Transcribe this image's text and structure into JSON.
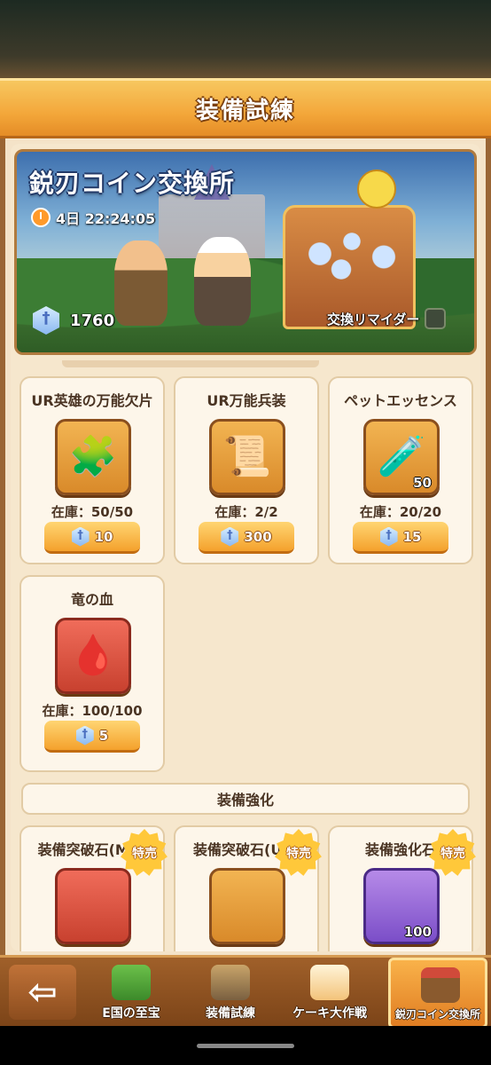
{
  "header": {
    "title": "装備試練"
  },
  "hero": {
    "title": "鋭刃コイン交換所",
    "timer": "4日 22:24:05",
    "balance": "1760",
    "reminder_label": "交換リマイダー"
  },
  "items": [
    {
      "name": "UR英雄の万能欠片",
      "glyph": "🧩",
      "qty": "",
      "stock": "在庫：50/50",
      "price": "10"
    },
    {
      "name": "UR万能兵装",
      "glyph": "📜",
      "qty": "",
      "stock": "在庫：2/2",
      "price": "300"
    },
    {
      "name": "ペットエッセンス",
      "glyph": "🧪",
      "qty": "50",
      "stock": "在庫：20/20",
      "price": "15"
    },
    {
      "name": "竜の血",
      "glyph": "🩸",
      "qty": "",
      "stock": "在庫：100/100",
      "price": "5"
    }
  ],
  "section": {
    "title": "装備強化"
  },
  "upgrade_items": [
    {
      "name": "装備突破石(MR)",
      "badge": "特売",
      "qty": ""
    },
    {
      "name": "装備突破石(UR)",
      "badge": "特売",
      "qty": ""
    },
    {
      "name": "装備強化石",
      "badge": "特売",
      "qty": "100"
    }
  ],
  "nav": {
    "back_icon": "arrow-left-icon",
    "back_glyph": "⇦",
    "tabs": [
      {
        "label": "E国の至宝",
        "active": false
      },
      {
        "label": "装備試練",
        "active": false
      },
      {
        "label": "ケーキ大作戦",
        "active": false
      },
      {
        "label": "鋭刃コイン交換所",
        "active": true
      }
    ]
  }
}
